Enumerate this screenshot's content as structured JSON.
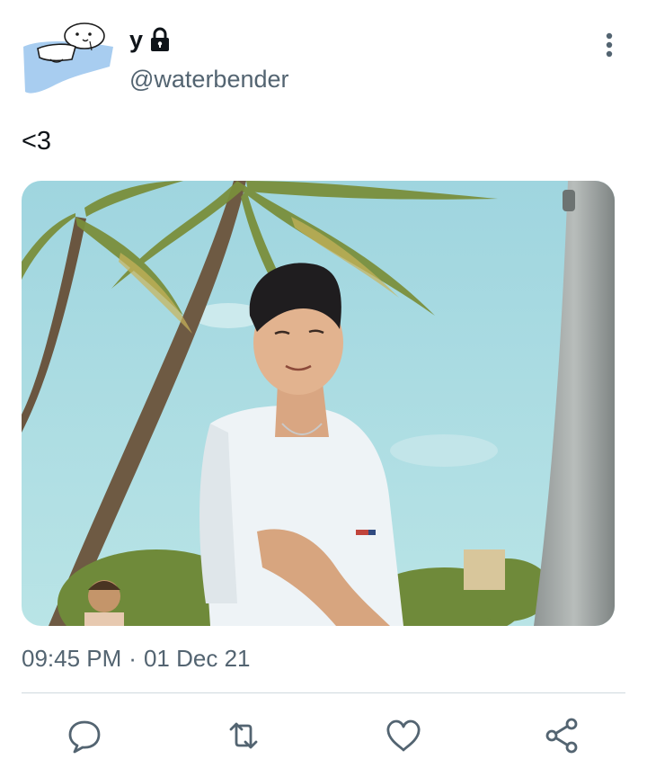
{
  "user": {
    "display_name": "y",
    "handle": "@waterbender",
    "protected_icon": "lock-icon",
    "avatar_icon": "cartoon-avatar"
  },
  "tweet": {
    "text": "<3",
    "time": "09:45 PM",
    "separator": "·",
    "date": "01 Dec 21",
    "media_description_icon": "photo-palm-trees"
  },
  "actions": {
    "reply_icon": "reply-icon",
    "retweet_icon": "retweet-icon",
    "like_icon": "heart-icon",
    "share_icon": "share-icon",
    "more_icon": "more-vertical-icon"
  },
  "colors": {
    "text_primary": "#0f1419",
    "text_secondary": "#536471",
    "icon_gray": "#536471",
    "divider": "#cfd9de",
    "sky": "#a9dbe3"
  }
}
